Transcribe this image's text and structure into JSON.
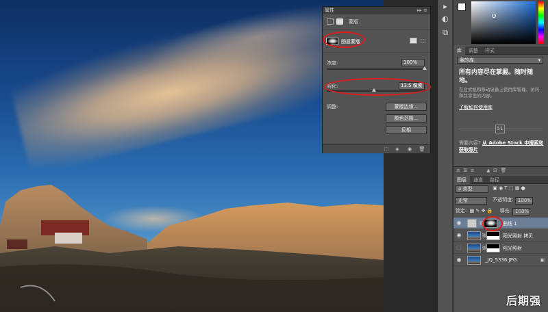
{
  "properties_panel": {
    "header_title": "属性",
    "header_controls": "▸▸ ≡",
    "sub_label": "蒙版",
    "mask_chip_label": "图层蒙版",
    "density_label": "浓度:",
    "density_value": "100%",
    "density_level": 1.0,
    "feather_label": "羽化:",
    "feather_value": "13.5 像素",
    "feather_level": 0.48,
    "adjust_label": "调整:",
    "btn_mask_edge": "蒙版边缘...",
    "btn_color_range": "颜色范围...",
    "btn_invert": "反相"
  },
  "library": {
    "tabs": [
      "库",
      "调整",
      "样式"
    ],
    "selected_library": "我的库",
    "headline": "所有内容尽在掌握。随时随地。",
    "description": "在台式机和移动设备上使用库管理、访问和共享您的内容。",
    "learn_link": "了解如何使用库",
    "icon_text": "51",
    "more_prefix": "需要内容?",
    "more_link": "从 Adobe Stock 中搜索和获取照片",
    "toolbar_icons": "≡  ⊞  ≡        ▲  ⊟  🗑"
  },
  "layers_panel": {
    "tabs": [
      "图层",
      "通道",
      "路径"
    ],
    "filter_label": "ρ 类型",
    "filter_icons": "▣ ◉ T ⬚ ▦ ●",
    "blend_mode": "正常",
    "opacity_label": "不透明度:",
    "opacity_value": "100%",
    "lock_label": "锁定:",
    "lock_icons": "▩ ✎ ✥ 🔒",
    "fill_label": "填充:",
    "fill_value": "100%",
    "layers": [
      {
        "name": "曲线 1",
        "visible": true,
        "selected": true
      },
      {
        "name": "阳光照射 拷贝",
        "visible": true,
        "selected": false
      },
      {
        "name": "阳光照射",
        "visible": false,
        "selected": false
      },
      {
        "name": "_JQ_5336.JPG",
        "visible": true,
        "selected": false
      }
    ]
  },
  "tools": [
    "▸",
    "◐",
    "⧉"
  ],
  "watermark": "后期强"
}
